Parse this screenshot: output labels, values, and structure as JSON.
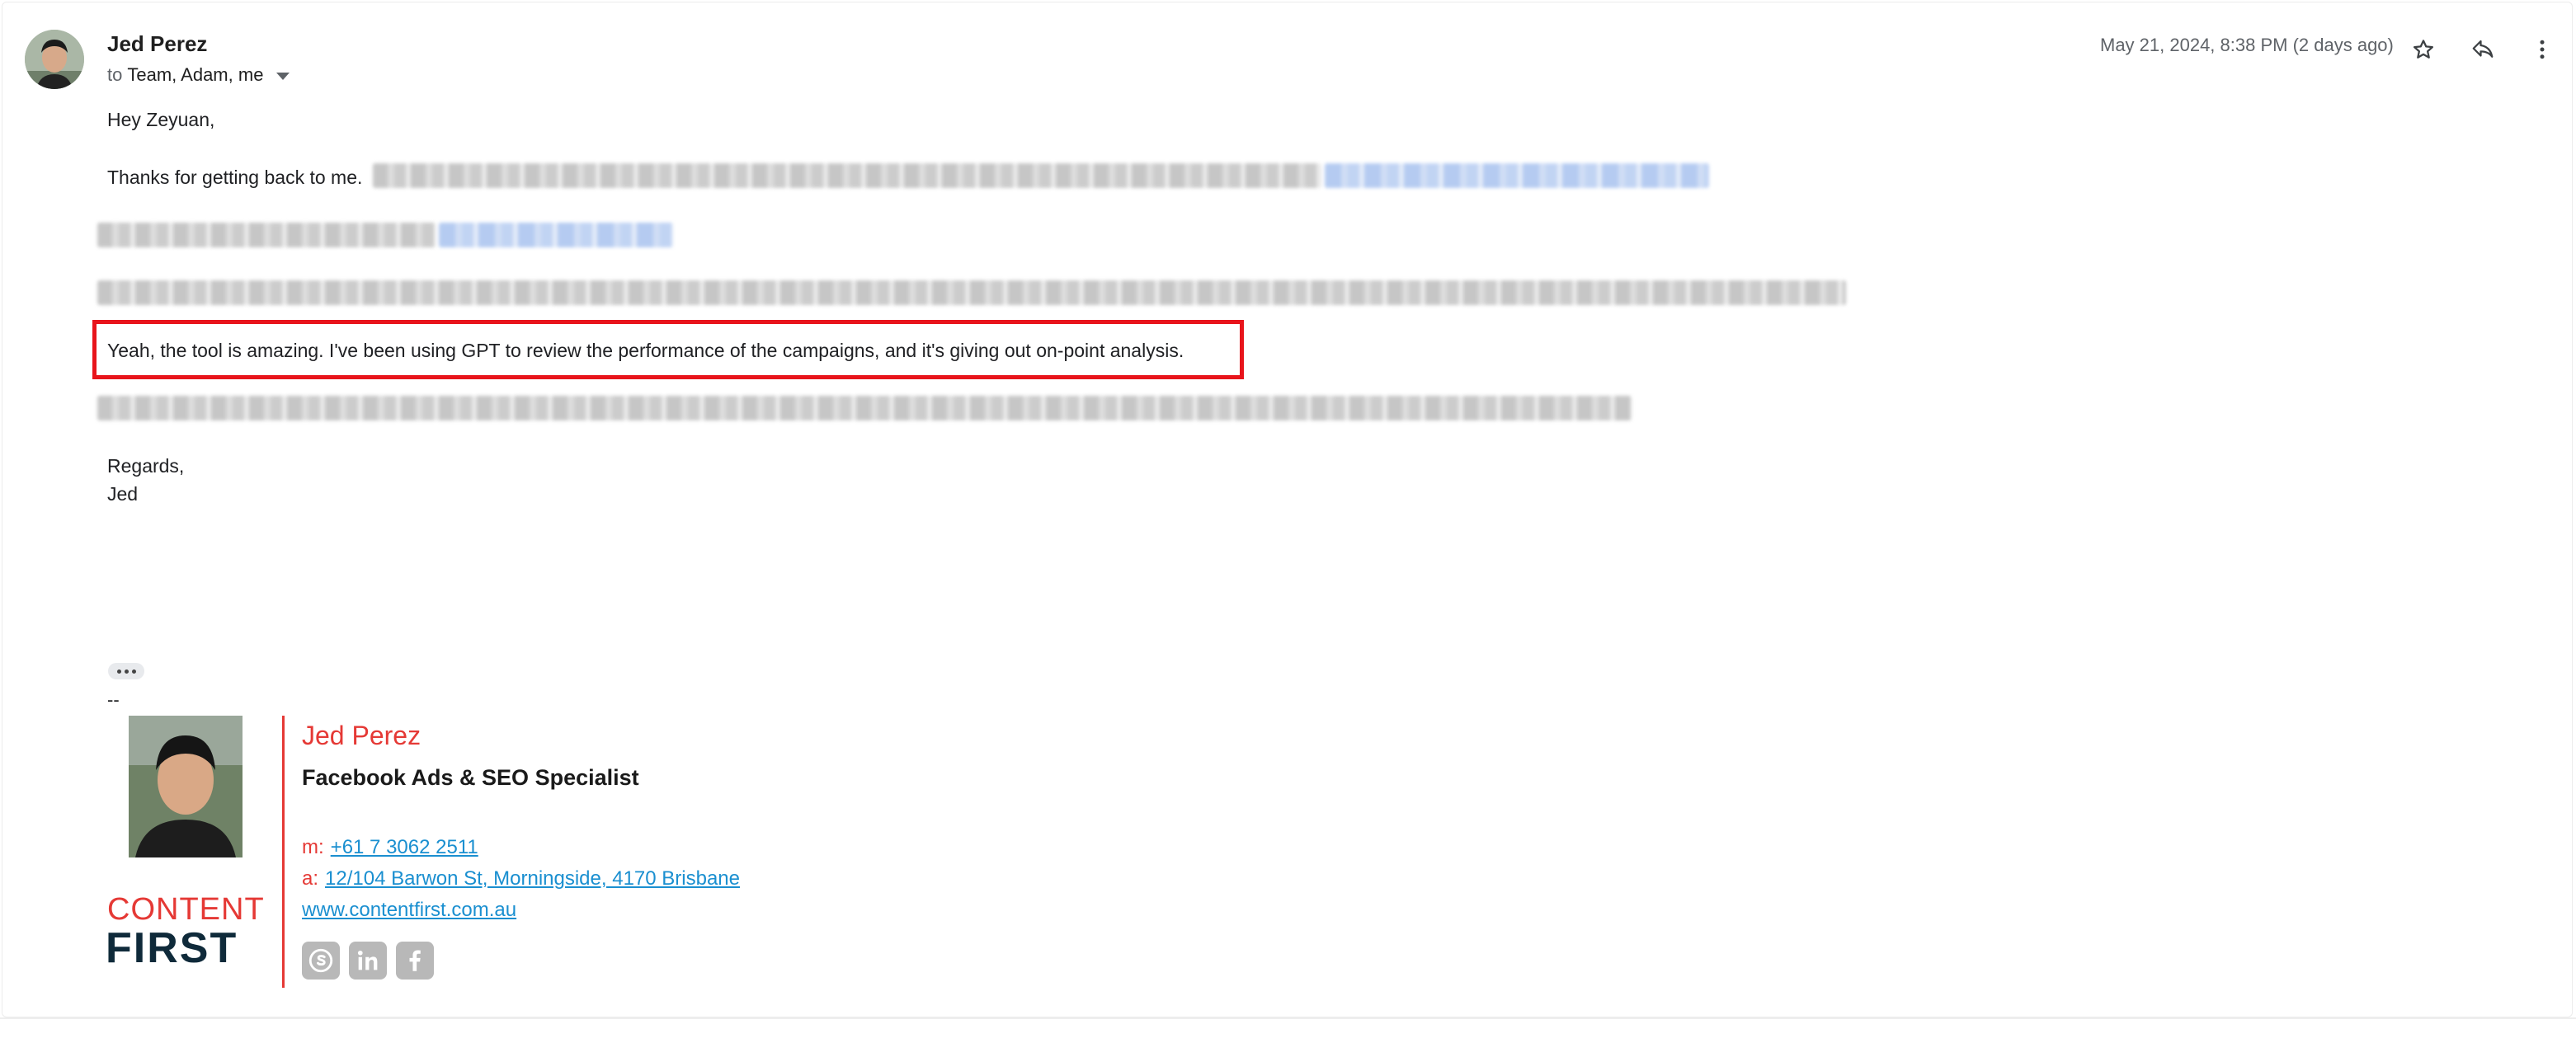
{
  "email": {
    "sender_name": "Jed Perez",
    "recipients_prefix": "to",
    "recipients": "Team, Adam, me",
    "timestamp": "May 21, 2024, 8:38 PM (2 days ago)",
    "icons": [
      "star-icon",
      "reply-icon",
      "more-vert-icon"
    ]
  },
  "body": {
    "greeting": "Hey Zeyuan,",
    "line1_visible": "Thanks for getting back to me.",
    "highlighted": "Yeah, the tool is amazing. I've been using GPT to review the performance of the campaigns, and it's giving out on-point analysis.",
    "closing": "Regards,",
    "closing_name": "Jed",
    "trimmed_marker": "--"
  },
  "signature": {
    "name": "Jed Perez",
    "title": "Facebook Ads & SEO Specialist",
    "mobile_label": "m:",
    "mobile": "+61 7 3062 2511",
    "address_label": "a:",
    "address": "12/104 Barwon St, Morningside, 4170 Brisbane",
    "website": "www.contentfirst.com.au",
    "logo_line1": "CONTENT",
    "logo_line2": "FIRST",
    "social_icons": [
      "skype-icon",
      "linkedin-icon",
      "facebook-icon"
    ]
  },
  "colors": {
    "highlight": "#e8141b",
    "accent_red": "#e53935",
    "link_blue": "#1a8fd0",
    "logo_navy": "#0f2a3a"
  }
}
